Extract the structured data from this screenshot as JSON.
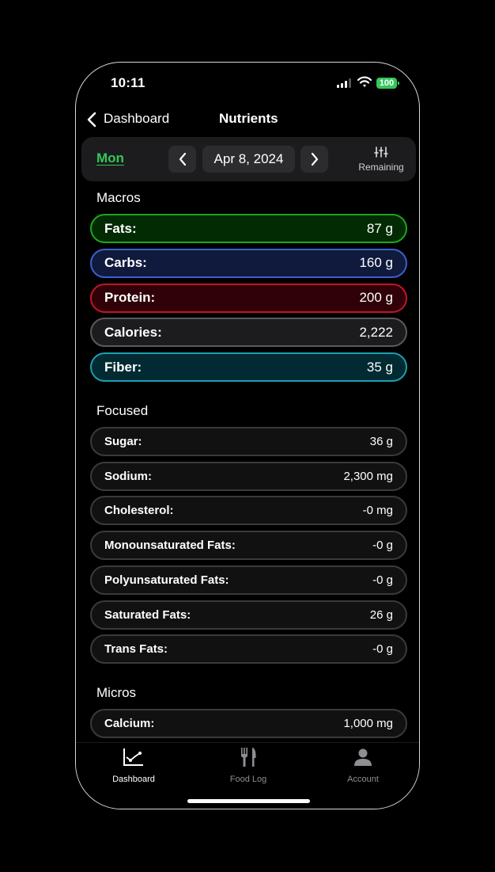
{
  "status_bar": {
    "time": "10:11",
    "battery": "100",
    "icons": [
      "signal-icon",
      "wifi-icon",
      "battery-icon"
    ]
  },
  "nav": {
    "back_label": "Dashboard",
    "title": "Nutrients"
  },
  "date_bar": {
    "day": "Mon",
    "date": "Apr 8, 2024",
    "remaining_label": "Remaining",
    "accent": "#34c759"
  },
  "macros": {
    "heading": "Macros",
    "items": [
      {
        "label": "Fats:",
        "value": "87 g",
        "border": "#1fa51f",
        "bg": "#032b03"
      },
      {
        "label": "Carbs:",
        "value": "160 g",
        "border": "#3c5fd0",
        "bg": "#0f1a3c"
      },
      {
        "label": "Protein:",
        "value": "200 g",
        "border": "#c0152a",
        "bg": "#300108"
      },
      {
        "label": "Calories:",
        "value": "2,222",
        "border": "#5a5a5c",
        "bg": "#1c1c1e"
      },
      {
        "label": "Fiber:",
        "value": "35 g",
        "border": "#1b9fb0",
        "bg": "#012a32"
      }
    ]
  },
  "focused": {
    "heading": "Focused",
    "items": [
      {
        "label": "Sugar:",
        "value": "36 g"
      },
      {
        "label": "Sodium:",
        "value": "2,300 mg"
      },
      {
        "label": "Cholesterol:",
        "value": "-0 mg"
      },
      {
        "label": "Monounsaturated Fats:",
        "value": "-0 g"
      },
      {
        "label": "Polyunsaturated Fats:",
        "value": "-0 g"
      },
      {
        "label": "Saturated Fats:",
        "value": "26 g"
      },
      {
        "label": "Trans Fats:",
        "value": "-0 g"
      }
    ]
  },
  "micros": {
    "heading": "Micros",
    "items": [
      {
        "label": "Calcium:",
        "value": "1,000 mg"
      }
    ]
  },
  "tabbar": {
    "items": [
      {
        "label": "Dashboard",
        "icon": "chart-line-icon",
        "active": true
      },
      {
        "label": "Food Log",
        "icon": "fork-knife-icon",
        "active": false
      },
      {
        "label": "Account",
        "icon": "person-icon",
        "active": false
      }
    ]
  }
}
